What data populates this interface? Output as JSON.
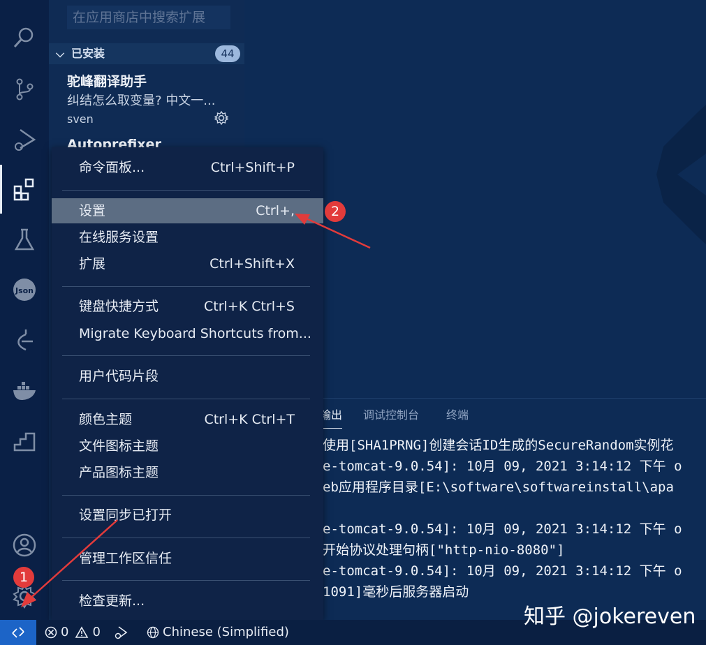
{
  "activity_bar": {
    "icons": [
      "search-icon",
      "source-control-icon",
      "run-debug-icon",
      "extensions-icon",
      "testing-icon",
      "json-icon",
      "git-graph-icon",
      "docker-icon",
      "stairs-icon",
      "account-icon",
      "manage-gear-icon"
    ]
  },
  "sidebar": {
    "search_placeholder": "在应用商店中搜索扩展",
    "section_title": "已安装",
    "section_count": "44",
    "extensions": [
      {
        "name": "驼峰翻译助手",
        "description": "纠结怎么取变量? 中文一...",
        "author": "sven"
      },
      {
        "name": "Autoprefixer"
      }
    ]
  },
  "panel": {
    "tabs": [
      "输出",
      "调试控制台",
      "终端"
    ],
    "log_lines": [
      "使用[SHA1PRNG]创建会话ID生成的SecureRandom实例花",
      "e-tomcat-9.0.54]: 10月 09, 2021 3:14:12 下午 o",
      "eb应用程序目录[E:\\software\\softwareinstall\\apa",
      "",
      "e-tomcat-9.0.54]: 10月 09, 2021 3:14:12 下午 o",
      "开始协议处理句柄[\"http-nio-8080\"]",
      "e-tomcat-9.0.54]: 10月 09, 2021 3:14:12 下午 o",
      "1091]毫秒后服务器启动"
    ]
  },
  "menu": {
    "items": [
      {
        "label": "命令面板...",
        "key": "Ctrl+Shift+P"
      },
      {
        "label": "设置",
        "key": "Ctrl+,"
      },
      {
        "label": "在线服务设置",
        "key": ""
      },
      {
        "label": "扩展",
        "key": "Ctrl+Shift+X"
      },
      {
        "label": "键盘快捷方式",
        "key": "Ctrl+K Ctrl+S"
      },
      {
        "label": "Migrate Keyboard Shortcuts from...",
        "key": ""
      },
      {
        "label": "用户代码片段",
        "key": ""
      },
      {
        "label": "颜色主题",
        "key": "Ctrl+K Ctrl+T"
      },
      {
        "label": "文件图标主题",
        "key": ""
      },
      {
        "label": "产品图标主题",
        "key": ""
      },
      {
        "label": "设置同步已打开",
        "key": ""
      },
      {
        "label": "管理工作区信任",
        "key": ""
      },
      {
        "label": "检查更新...",
        "key": ""
      }
    ],
    "highlighted_item": "设置"
  },
  "status_bar": {
    "errors": "0",
    "warnings": "0",
    "language": "Chinese (Simplified)"
  },
  "annotations": {
    "step1": "1",
    "step2": "2",
    "arrow_color": "#e23b3b"
  },
  "watermark": "知乎 @jokereven",
  "colors": {
    "background": "#0d2b55",
    "menu_background": "#0f2347",
    "menu_highlight": "#5c6d83",
    "remote_button": "#1c64c7"
  }
}
